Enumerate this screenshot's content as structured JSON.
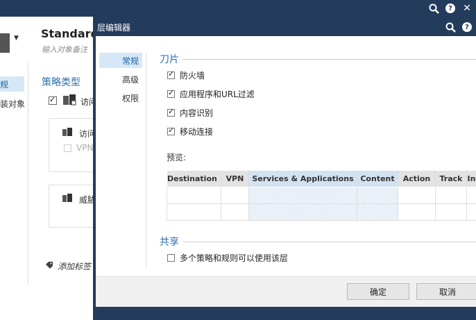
{
  "background": {
    "layer_name": "Standard",
    "layer_note": "输入对象备注",
    "nav": [
      "规",
      "装对象"
    ],
    "section": "策略类型",
    "access_label": "访问",
    "card1": {
      "title": "访问",
      "vpn": "VPN"
    },
    "card2": {
      "title": "威胁"
    },
    "tag": "添加标签"
  },
  "dialog": {
    "title": "层编辑器",
    "nav": [
      {
        "label": "常规",
        "active": true
      },
      {
        "label": "高级",
        "active": false
      },
      {
        "label": "权限",
        "active": false
      }
    ],
    "blades_title": "刀片",
    "blades": [
      {
        "label": "防火墙",
        "checked": true
      },
      {
        "label": "应用程序和URL过滤",
        "checked": true
      },
      {
        "label": "内容识别",
        "checked": true
      },
      {
        "label": "移动连接",
        "checked": true
      }
    ],
    "preview_label": "预览:",
    "preview_columns": [
      {
        "label": "Destination",
        "highlight": false
      },
      {
        "label": "VPN",
        "highlight": false
      },
      {
        "label": "Services & Applications",
        "highlight": true
      },
      {
        "label": "Content",
        "highlight": true
      },
      {
        "label": "Action",
        "highlight": false
      },
      {
        "label": "Track",
        "highlight": false
      },
      {
        "label": "In",
        "highlight": false
      }
    ],
    "sharing_title": "共享",
    "sharing_option": {
      "label": "多个策略和规则可以使用该层",
      "checked": false
    },
    "ok_label": "确定",
    "cancel_label": "取消"
  },
  "colors": {
    "titlebar": "#243c5c",
    "accent": "#2a6fb0",
    "nav_active": "#d6e8f7"
  }
}
